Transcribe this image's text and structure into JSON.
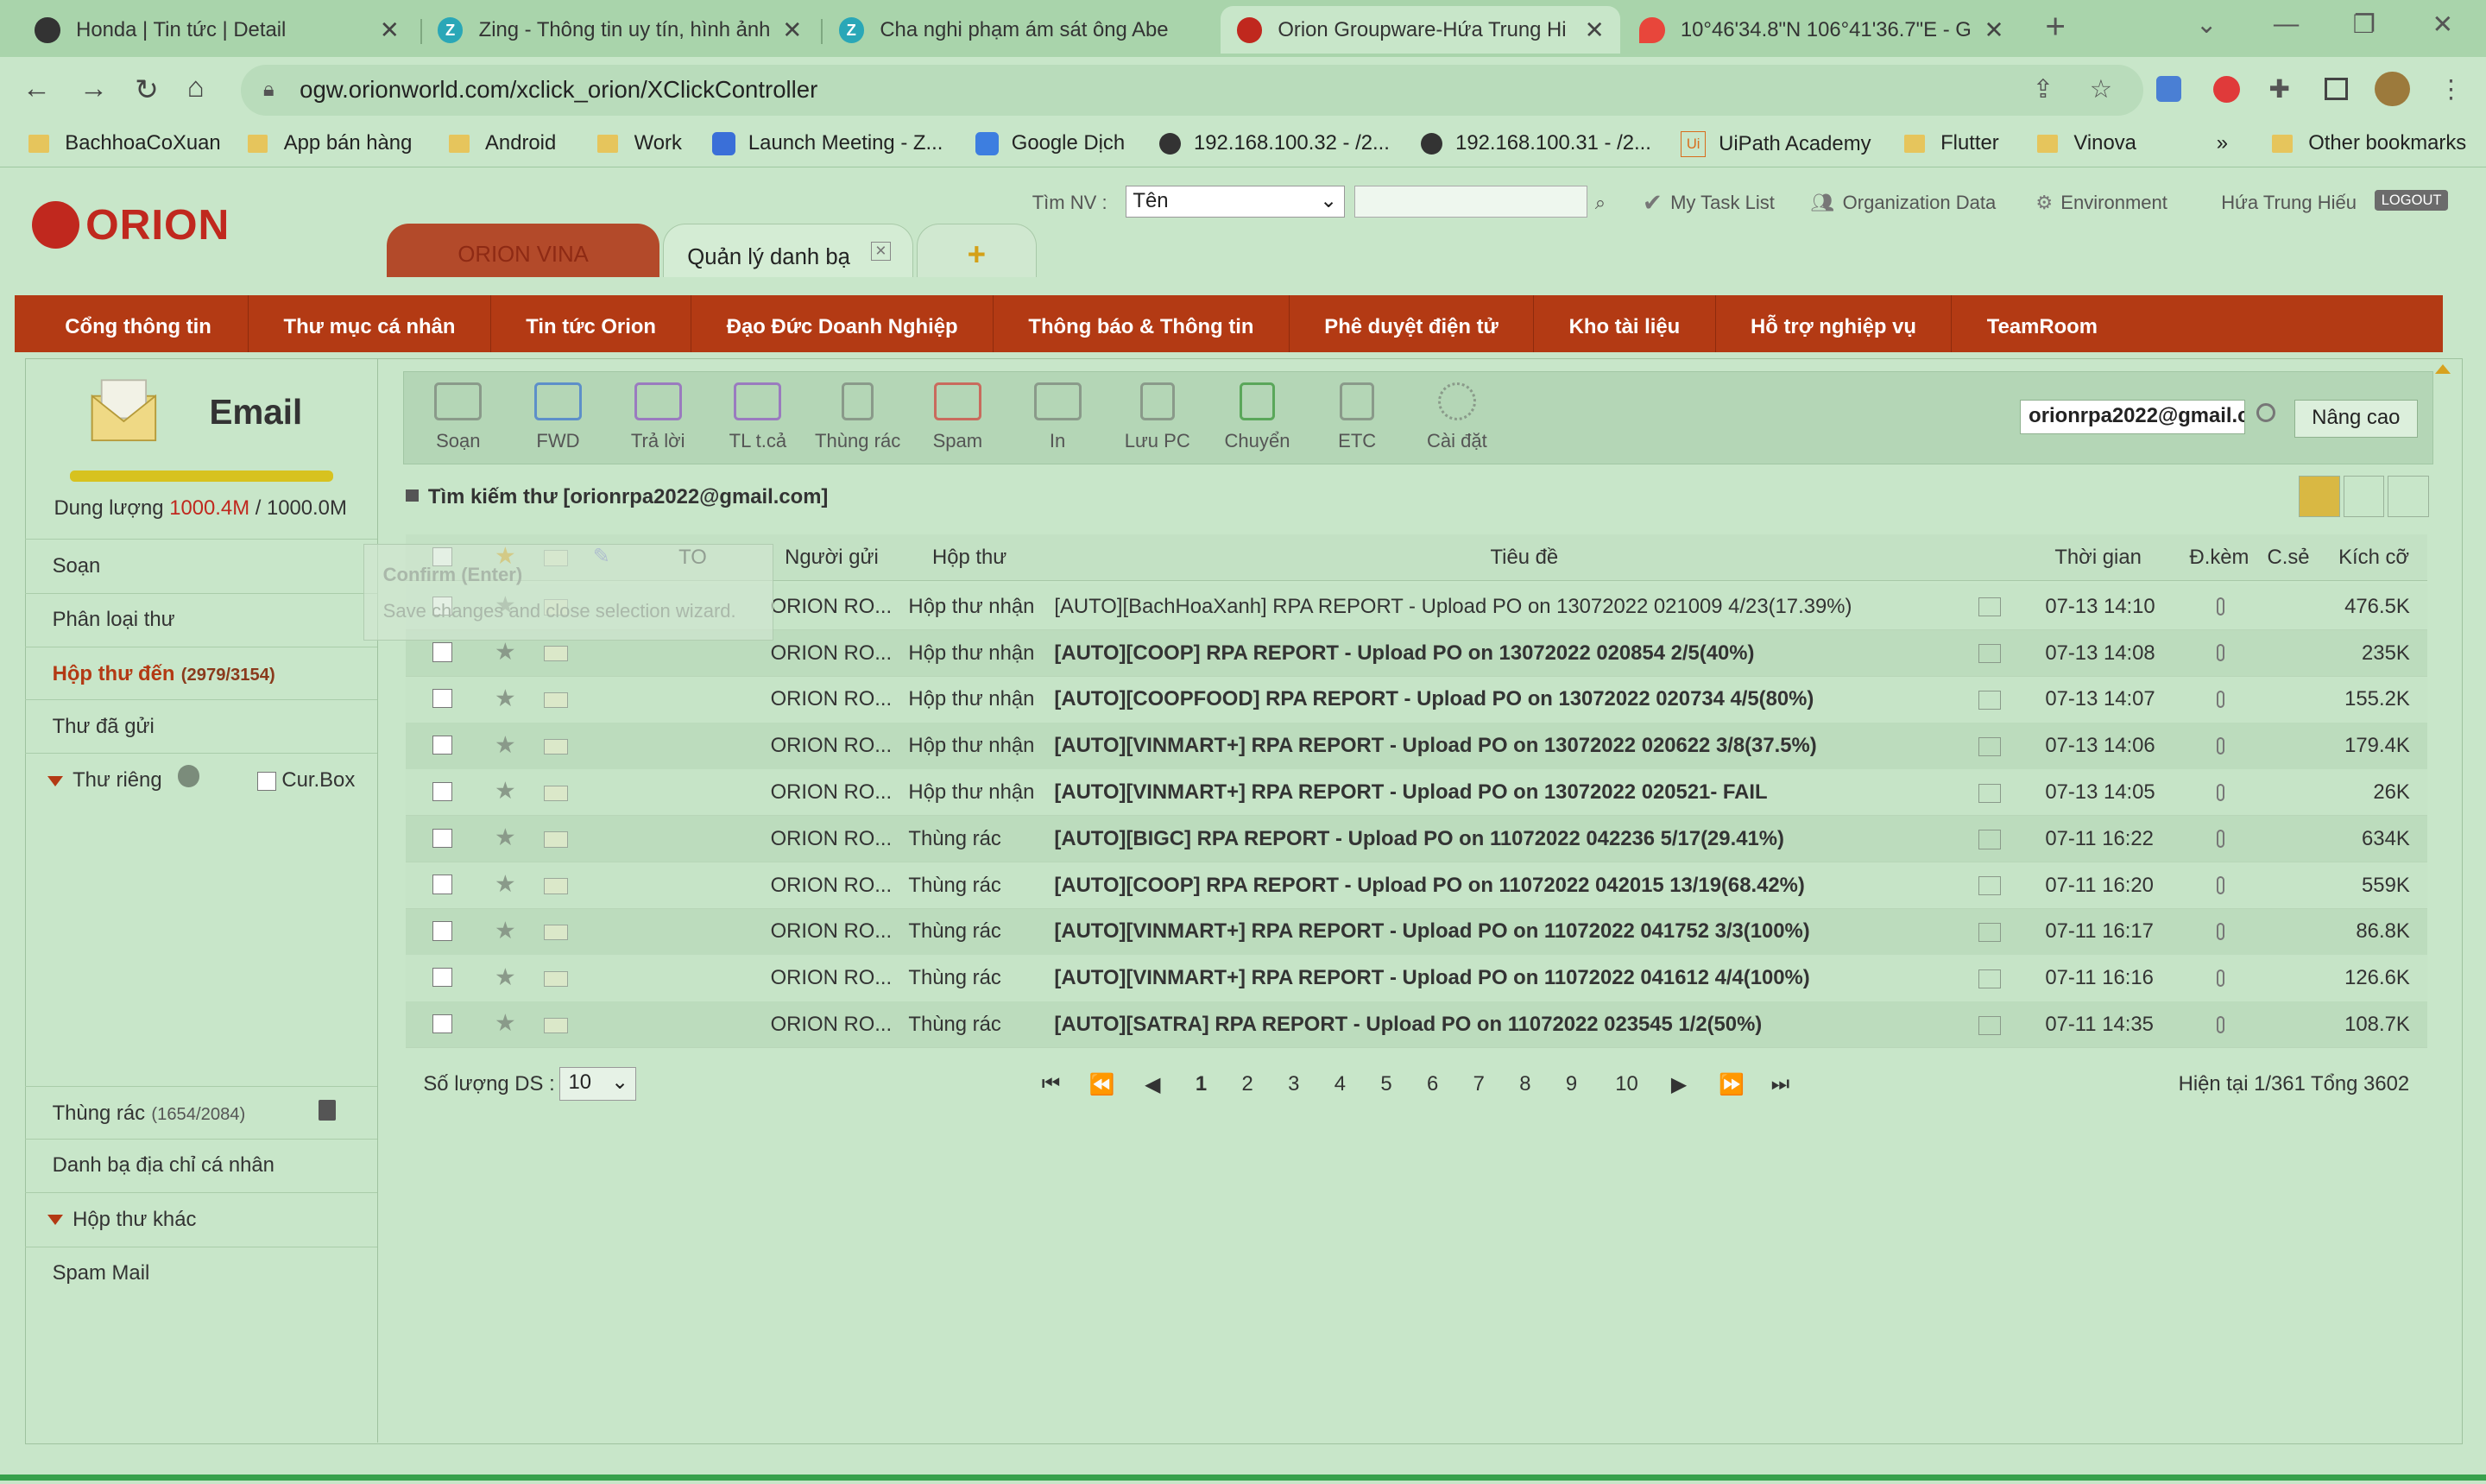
{
  "browser": {
    "tabs": [
      {
        "title": "Honda | Tin tức | Detail",
        "active": false
      },
      {
        "title": "Zing - Thông tin uy tín, hình ảnh",
        "active": false
      },
      {
        "title": "Cha nghi phạm ám sát ông Abe",
        "active": false
      },
      {
        "title": "Orion Groupware-Hứa Trung Hi",
        "active": true
      },
      {
        "title": "10°46'34.8\"N 106°41'36.7\"E - G",
        "active": false
      }
    ],
    "url": "ogw.orionworld.com/xclick_orion/XClickController",
    "bookmarks": [
      "BachhoaCoXuan",
      "App bán hàng",
      "Android",
      "Work",
      "Launch Meeting - Z...",
      "Google Dịch",
      "192.168.100.32 - /2...",
      "192.168.100.31 - /2...",
      "UiPath Academy",
      "Flutter",
      "Vinova"
    ],
    "other_bookmarks": "Other bookmarks",
    "overflow": "»"
  },
  "header": {
    "logo": "ORION",
    "tabs": {
      "company": "ORION VINA",
      "current": "Quản lý danh bạ",
      "add": "+"
    },
    "search_label": "Tìm NV :",
    "search_select": "Tên",
    "links": [
      "My Task List",
      "Organization Data",
      "Environment"
    ],
    "user": "Hứa Trung Hiếu",
    "logout": "LOGOUT"
  },
  "menu": [
    "Cổng thông tin",
    "Thư mục cá nhân",
    "Tin tức Orion",
    "Đạo Đức Doanh Nghiệp",
    "Thông báo & Thông tin",
    "Phê duyệt điện tử",
    "Kho tài liệu",
    "Hỗ trợ nghiệp vụ",
    "TeamRoom"
  ],
  "sidebar": {
    "title": "Email",
    "quota_label": "Dung lượng",
    "quota_used": "1000.4M",
    "quota_total": " / 1000.0M",
    "compose": "Soạn",
    "classify": "Phân loại thư",
    "inbox": "Hộp thư đến",
    "inbox_count": "(2979/3154)",
    "sent": "Thư đã gửi",
    "private": "Thư riêng",
    "curbox": "Cur.Box",
    "trash": "Thùng rác",
    "trash_count": "(1654/2084)",
    "contacts": "Danh bạ địa chỉ cá nhân",
    "other_boxes": "Hộp thư khác",
    "spam": "Spam Mail"
  },
  "toolbar": {
    "buttons": [
      "Soạn",
      "FWD",
      "Trả lời",
      "TL t.cả",
      "Thùng rác",
      "Spam",
      "In",
      "Lưu PC",
      "Chuyển",
      "ETC",
      "Cài đặt"
    ],
    "search_value": "orionrpa2022@gmail.c",
    "advanced": "Nâng cao"
  },
  "search_title": "Tìm kiếm thư [orionrpa2022@gmail.com]",
  "tooltip": {
    "title": "Confirm (Enter)",
    "body": "Save changes and close selection wizard."
  },
  "columns": {
    "to": "TO",
    "sender": "Người gửi",
    "folder": "Hộp thư",
    "subject": "Tiêu đề",
    "time": "Thời gian",
    "attach": "Đ.kèm",
    "flag": "C.sẻ",
    "size": "Kích cỡ"
  },
  "emails": [
    {
      "sender": "ORION RO...",
      "folder": "Hộp thư nhận",
      "subject": "[AUTO][BachHoaXanh] RPA REPORT - Upload PO on 13072022 021009 4/23(17.39%)",
      "time": "07-13 14:10",
      "size": "476.5K",
      "read": true
    },
    {
      "sender": "ORION RO...",
      "folder": "Hộp thư nhận",
      "subject": "[AUTO][COOP] RPA REPORT - Upload PO on 13072022 020854 2/5(40%)",
      "time": "07-13 14:08",
      "size": "235K",
      "read": false
    },
    {
      "sender": "ORION RO...",
      "folder": "Hộp thư nhận",
      "subject": "[AUTO][COOPFOOD] RPA REPORT - Upload PO on 13072022 020734 4/5(80%)",
      "time": "07-13 14:07",
      "size": "155.2K",
      "read": false
    },
    {
      "sender": "ORION RO...",
      "folder": "Hộp thư nhận",
      "subject": "[AUTO][VINMART+] RPA REPORT - Upload PO on 13072022 020622 3/8(37.5%)",
      "time": "07-13 14:06",
      "size": "179.4K",
      "read": false
    },
    {
      "sender": "ORION RO...",
      "folder": "Hộp thư nhận",
      "subject": "[AUTO][VINMART+] RPA REPORT - Upload PO on 13072022 020521- FAIL",
      "time": "07-13 14:05",
      "size": "26K",
      "read": false
    },
    {
      "sender": "ORION RO...",
      "folder": "Thùng rác",
      "subject": "[AUTO][BIGC] RPA REPORT - Upload PO on 11072022 042236 5/17(29.41%)",
      "time": "07-11 16:22",
      "size": "634K",
      "read": false
    },
    {
      "sender": "ORION RO...",
      "folder": "Thùng rác",
      "subject": "[AUTO][COOP] RPA REPORT - Upload PO on 11072022 042015 13/19(68.42%)",
      "time": "07-11 16:20",
      "size": "559K",
      "read": false
    },
    {
      "sender": "ORION RO...",
      "folder": "Thùng rác",
      "subject": "[AUTO][VINMART+] RPA REPORT - Upload PO on 11072022 041752 3/3(100%)",
      "time": "07-11 16:17",
      "size": "86.8K",
      "read": false
    },
    {
      "sender": "ORION RO...",
      "folder": "Thùng rác",
      "subject": "[AUTO][VINMART+] RPA REPORT - Upload PO on 11072022 041612 4/4(100%)",
      "time": "07-11 16:16",
      "size": "126.6K",
      "read": false
    },
    {
      "sender": "ORION RO...",
      "folder": "Thùng rác",
      "subject": "[AUTO][SATRA] RPA REPORT - Upload PO on 11072022 023545 1/2(50%)",
      "time": "07-11 14:35",
      "size": "108.7K",
      "read": false
    }
  ],
  "pager": {
    "count_label": "Số lượng DS :",
    "count_value": "10",
    "pages": [
      "1",
      "2",
      "3",
      "4",
      "5",
      "6",
      "7",
      "8",
      "9",
      "10"
    ],
    "status": "Hiện tại 1/361 Tổng 3602"
  },
  "colors": {
    "menu": "#b33a14",
    "accent": "#c0281e",
    "overlay": "#c8e6c9"
  }
}
